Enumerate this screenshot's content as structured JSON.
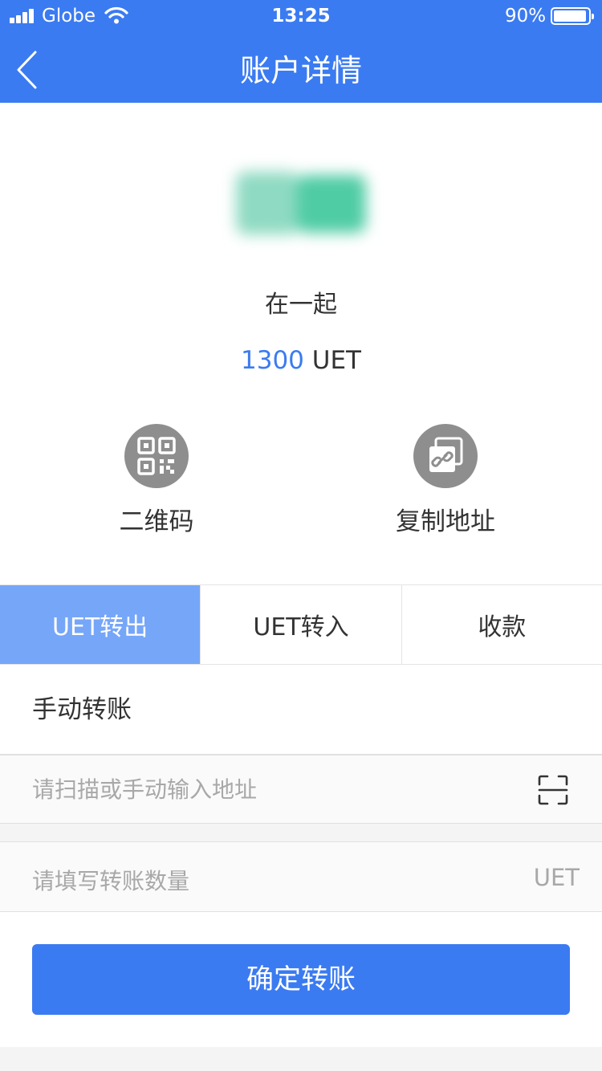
{
  "status_bar": {
    "carrier": "Globe",
    "time": "13:25",
    "battery_percent": "90%",
    "battery_level": 0.9,
    "signal_icon": "signal-bars-icon",
    "wifi_icon": "wifi-icon"
  },
  "nav": {
    "title": "账户详情",
    "back_icon": "chevron-left-icon"
  },
  "account": {
    "name": "在一起",
    "balance_amount": "1300",
    "balance_unit": " UET",
    "avatar_icon": "blurred-avatar-image"
  },
  "actions": [
    {
      "label": "二维码",
      "icon": "qr-code-icon"
    },
    {
      "label": "复制地址",
      "icon": "copy-link-icon"
    }
  ],
  "tabs": [
    {
      "label": "UET转出",
      "active": true
    },
    {
      "label": "UET转入",
      "active": false
    },
    {
      "label": "收款",
      "active": false
    }
  ],
  "form": {
    "section_title": "手动转账",
    "address_placeholder": "请扫描或手动输入地址",
    "scan_icon": "scan-icon",
    "amount_placeholder": "请填写转账数量",
    "amount_unit": "UET",
    "confirm_label": "确定转账"
  },
  "colors": {
    "primary": "#3b7bf1",
    "tab_active": "#76a6f8",
    "icon_circle": "#8e8e8e"
  }
}
